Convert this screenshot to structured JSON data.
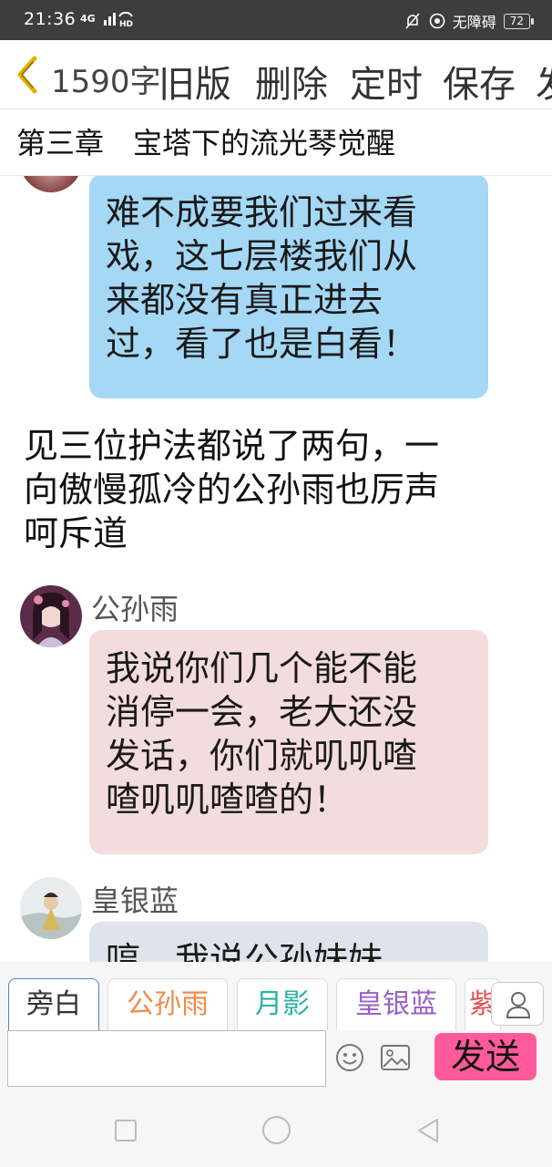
{
  "status_bar": {
    "time": "21:36",
    "signal": "4G",
    "network": "HD",
    "accessibility": "无障碍",
    "battery": "72"
  },
  "toolbar": {
    "char_count": "1590字",
    "old_version": "旧版",
    "delete": "删除",
    "schedule": "定时",
    "save": "保存",
    "publish_partial": "发"
  },
  "chapter": {
    "title": "第三章　宝塔下的流光琴觉醒"
  },
  "messages": [
    {
      "type": "bubble",
      "style": "blue",
      "lines": [
        "难不成要我们过来看",
        "戏，这七层楼我们从",
        "来都没有真正进去",
        "过，看了也是白看！"
      ]
    },
    {
      "type": "narration",
      "lines": [
        "见三位护法都说了两句，一",
        "向傲慢孤冷的公孙雨也厉声",
        "呵斥道"
      ]
    },
    {
      "type": "bubble",
      "style": "pink",
      "speaker": "公孙雨",
      "lines": [
        "我说你们几个能不能",
        "消停一会，老大还没",
        "发话，你们就叽叽喳",
        "喳叽叽喳喳的！"
      ]
    },
    {
      "type": "bubble",
      "style": "gray",
      "speaker": "皇银蓝",
      "lines": [
        "哼，我说公孙妹妹"
      ]
    }
  ],
  "roles": [
    {
      "label": "旁白",
      "color": "#333333"
    },
    {
      "label": "公孙雨",
      "color": "#f08a4b"
    },
    {
      "label": "月影",
      "color": "#2bb3a3"
    },
    {
      "label": "皇银蓝",
      "color": "#9a5fc9"
    },
    {
      "label": "紫",
      "color": "#e05555"
    }
  ],
  "input": {
    "placeholder": "",
    "send_label": "发送"
  },
  "colors": {
    "bubble_blue": "#a4d8f5",
    "bubble_pink": "#f3dcdd",
    "bubble_gray": "#dfe4ec",
    "send_button": "#ff5a9b"
  },
  "icons": {
    "back": "chevron-left-icon",
    "contact": "person-icon",
    "emoji": "smiley-icon",
    "image": "image-icon"
  }
}
